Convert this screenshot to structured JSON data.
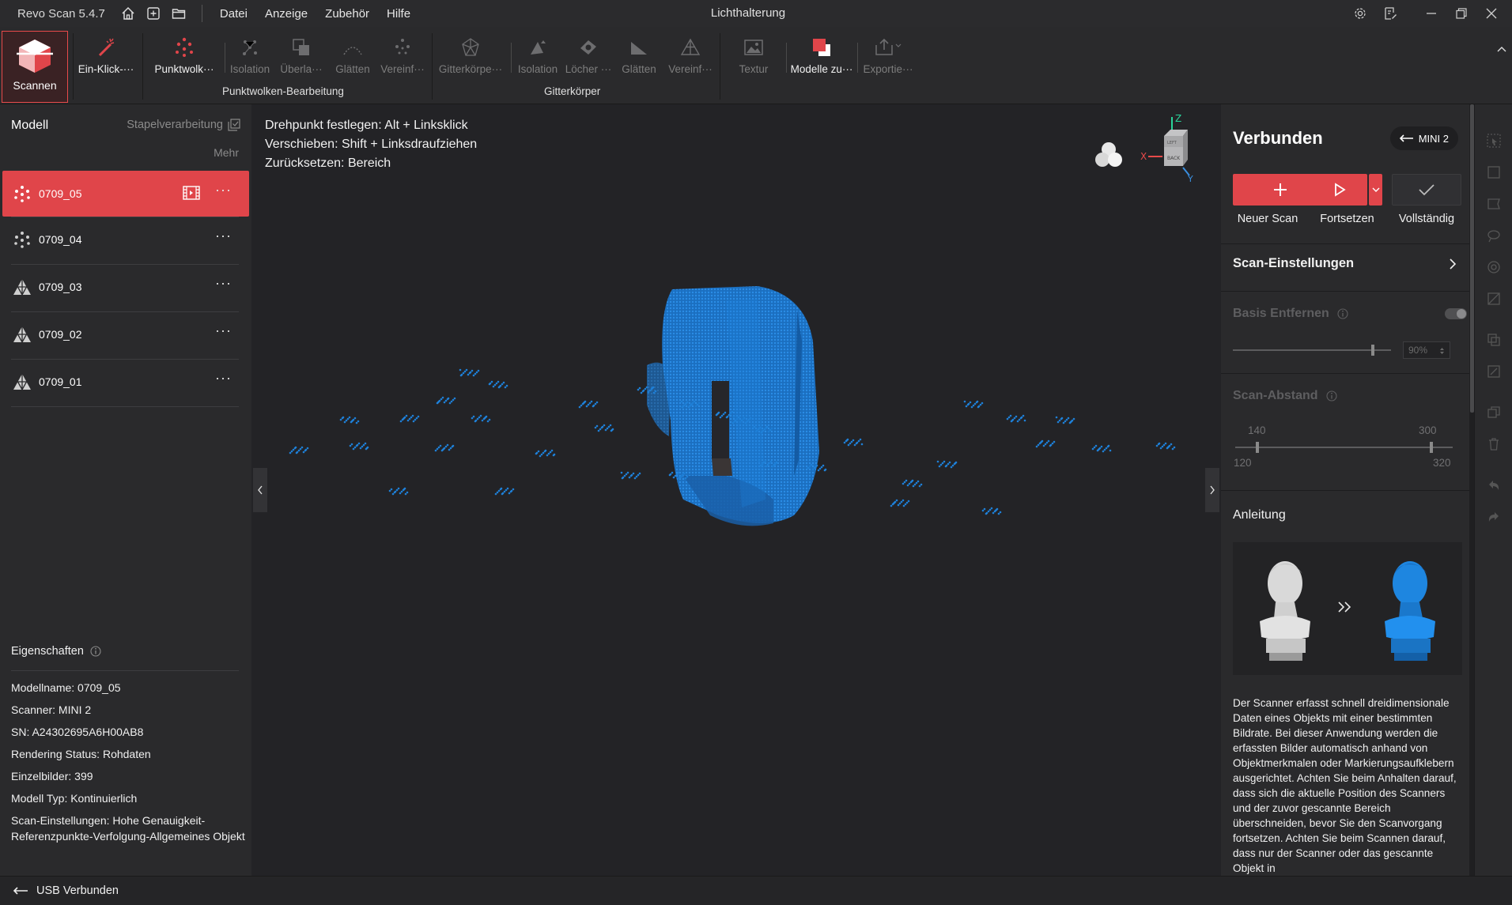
{
  "titlebar": {
    "app_name": "Revo Scan 5.4.7",
    "window_title": "Lichthalterung",
    "menu": [
      "Datei",
      "Anzeige",
      "Zubehör",
      "Hilfe"
    ]
  },
  "toolbar": {
    "scan_label": "Scannen",
    "one_click_label": "Ein-Klick-···",
    "point_cloud_label": "Punktwolk···",
    "pc_isolation": "Isolation",
    "pc_overlap": "Überla···",
    "pc_smooth": "Glätten",
    "pc_simplify": "Vereinf···",
    "mesh_label": "Gitterkörpe···",
    "mesh_isolation": "Isolation",
    "mesh_holes": "Löcher ···",
    "mesh_smooth": "Glätten",
    "mesh_simplify": "Vereinf···",
    "texture": "Textur",
    "models": "Modelle zu···",
    "export": "Exportie···",
    "group_pointcloud": "Punktwolken-Bearbeitung",
    "group_mesh": "Gitterkörper"
  },
  "left_panel": {
    "title": "Modell",
    "batch": "Stapelverarbeitung",
    "more": "Mehr",
    "models": [
      {
        "name": "0709_05",
        "type": "pointcloud"
      },
      {
        "name": "0709_04",
        "type": "pointcloud"
      },
      {
        "name": "0709_03",
        "type": "mesh"
      },
      {
        "name": "0709_02",
        "type": "mesh"
      },
      {
        "name": "0709_01",
        "type": "mesh"
      }
    ],
    "properties_title": "Eigenschaften",
    "properties": {
      "model_name": "Modellname:  0709_05",
      "scanner": "Scanner:  MINI 2",
      "sn": "SN:  A24302695A6H00AB8",
      "render_status": "Rendering Status:  Rohdaten",
      "frames": "Einzelbilder:  399",
      "model_type": "Modell Typ:  Kontinuierlich",
      "scan_settings": "Scan-Einstellungen:  Hohe Genauigkeit-Referenzpunkte-Verfolgung-Allgemeines Objekt"
    }
  },
  "viewport": {
    "hint_pivot_key": "Drehpunkt festlegen:",
    "hint_pivot_val": "Alt + Linksklick",
    "hint_move_key": "Verschieben:",
    "hint_move_val": "Shift + Linksdraufziehen",
    "hint_reset_key": "Zurücksetzen:",
    "hint_reset_val": "Bereich",
    "axis_z": "Z",
    "axis_x": "X",
    "axis_y": "Y",
    "cube_top": "LEFT",
    "cube_front": "BACK",
    "point_color": "#1e7fd6"
  },
  "right_panel": {
    "status": "Verbunden",
    "device": "MINI 2",
    "new_scan": "Neuer Scan",
    "continue": "Fortsetzen",
    "complete": "Vollständig",
    "scan_settings": "Scan-Einstellungen",
    "remove_base": "Basis Entfernen",
    "base_percent": "90%",
    "scan_distance": "Scan-Abstand",
    "dist_low_val": "140",
    "dist_high_val": "300",
    "dist_min": "120",
    "dist_max": "320",
    "guide_title": "Anleitung",
    "guide_text": "Der Scanner erfasst schnell dreidimensionale Daten eines Objekts mit einer bestimmten Bildrate. Bei dieser Anwendung werden die erfassten Bilder automatisch anhand von Objektmerkmalen oder Markierungsaufklebern ausgerichtet. Achten Sie beim Anhalten darauf, dass sich die aktuelle Position des Scanners und der zuvor gescannte Bereich überschneiden, bevor Sie den Scanvorgang fortsetzen. Achten Sie beim Scannen darauf, dass nur der Scanner oder das gescannte Objekt in",
    "accent": "#e0454a"
  },
  "statusbar": {
    "connection": "USB Verbunden"
  }
}
